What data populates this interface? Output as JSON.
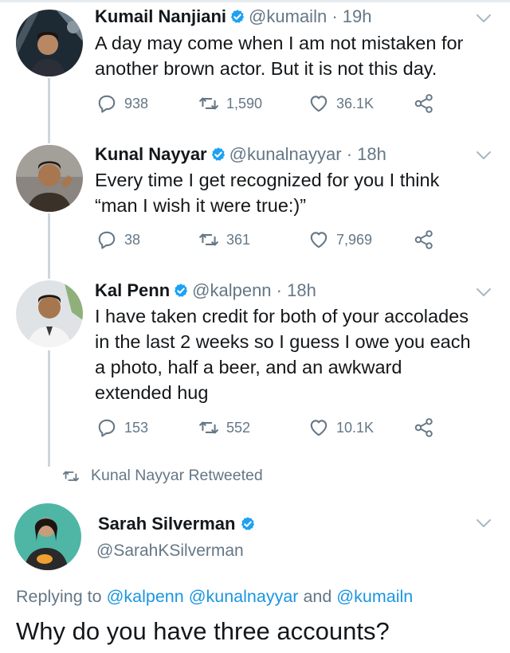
{
  "colors": {
    "text": "#14171a",
    "secondary": "#657786",
    "link": "#1b95e0",
    "verified": "#1da1f2",
    "thread_line": "#ccd6dd"
  },
  "tweets": [
    {
      "name": "Kumail Nanjiani",
      "handle": "@kumailn",
      "separator": "·",
      "time": "19h",
      "lines": [
        "A day may come when I am not mistaken for",
        "another brown actor. But it is not this day."
      ],
      "replies": "938",
      "retweets": "1,590",
      "likes": "36.1K",
      "verified": true
    },
    {
      "name": "Kunal Nayyar",
      "handle": "@kunalnayyar",
      "separator": "·",
      "time": "18h",
      "lines": [
        "Every time I get recognized for you I think",
        "“man I wish it were true:)”"
      ],
      "replies": "38",
      "retweets": "361",
      "likes": "7,969",
      "verified": true
    },
    {
      "name": "Kal Penn",
      "handle": "@kalpenn",
      "separator": "·",
      "time": "18h",
      "lines": [
        "I have taken credit for both of your accolades",
        "in the last 2 weeks so I guess I owe you each",
        "a photo, half a beer, and an awkward",
        "extended hug"
      ],
      "replies": "153",
      "retweets": "552",
      "likes": "10.1K",
      "verified": true
    }
  ],
  "retweeted_label": "Kunal Nayyar Retweeted",
  "focused_tweet": {
    "name": "Sarah Silverman",
    "handle": "@SarahKSilverman",
    "verified": true,
    "replying_prefix": "Replying to",
    "mentions": [
      "@kalpenn",
      "@kunalnayyar",
      "@kumailn"
    ],
    "replying_and": "and",
    "text": "Why do you have three accounts?"
  },
  "icons": [
    "reply-icon",
    "retweet-icon",
    "like-icon",
    "share-icon",
    "verified-badge-icon",
    "caret-down-icon"
  ]
}
